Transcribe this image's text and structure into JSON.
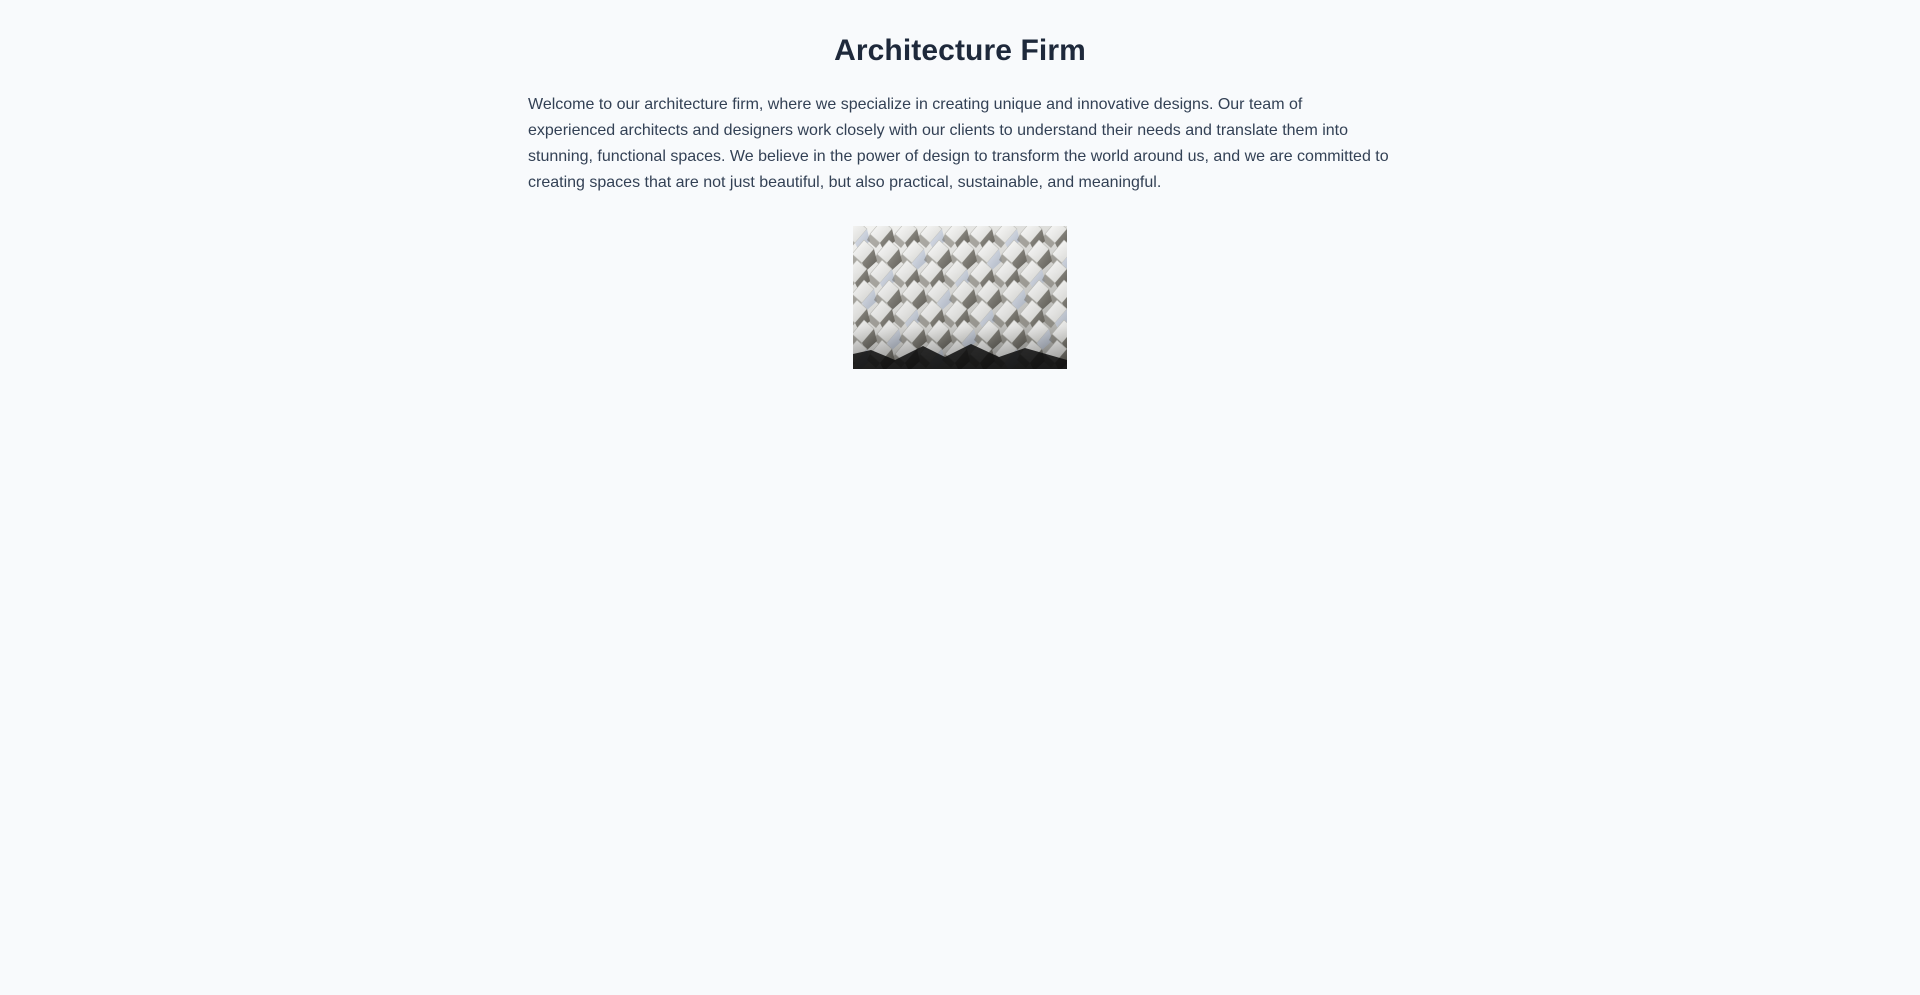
{
  "header": {
    "title": "Architecture Firm"
  },
  "main": {
    "intro": "Welcome to our architecture firm, where we specialize in creating unique and innovative designs. Our team of experienced architects and designers work closely with our clients to understand their needs and translate them into stunning, functional spaces. We believe in the power of design to transform the world around us, and we are committed to creating spaces that are not just beautiful, but also practical, sustainable, and meaningful.",
    "hero_image": {
      "icon": "architecture-facade-image"
    }
  },
  "theme": {
    "background": "#f8fafc",
    "heading_color": "#1e293b",
    "text_color": "#334155"
  }
}
